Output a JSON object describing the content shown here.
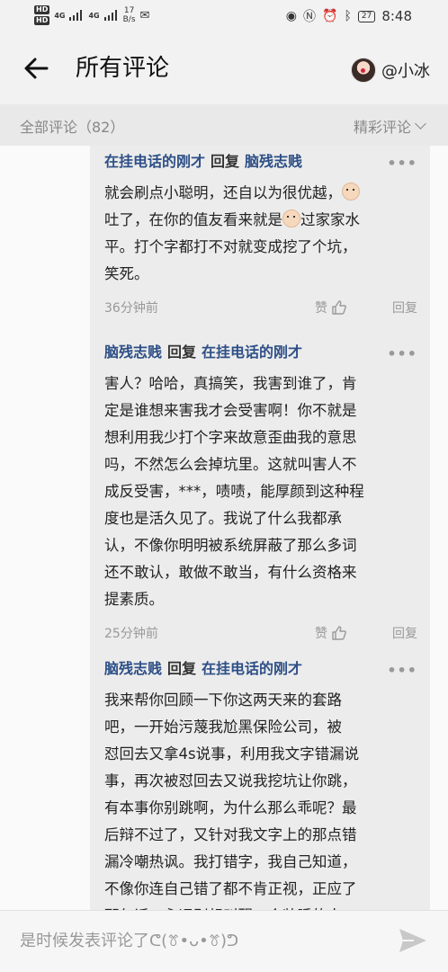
{
  "status_bar": {
    "hd1": "HD",
    "hd2": "HD",
    "net1": "4G",
    "net2": "4G",
    "speed_value": "17",
    "speed_unit": "B/s",
    "battery": "27",
    "time": "8:48"
  },
  "header": {
    "title": "所有评论",
    "username": "@小冰"
  },
  "filter": {
    "all_label": "全部评论（82）",
    "selected_label": "精彩评论"
  },
  "replies": [
    {
      "author": "在挂电话的刚才",
      "reply_word": "回复",
      "target": "脑残志贱",
      "line1a": "就会刷点小聪明，还自以为很优越，",
      "line2a": "吐了，在你的值友看来就是",
      "line2b": "过家家水",
      "rest": "平。打个字都打不对就变成挖了个坑，\n笑死。",
      "time": "36分钟前",
      "like": "赞",
      "reply": "回复"
    },
    {
      "author": "脑残志贱",
      "reply_word": "回复",
      "target": "在挂电话的刚才",
      "body": "害人？哈哈，真搞笑，我害到谁了，肯\n定是谁想来害我才会受害啊！你不就是\n想利用我少打个字来故意歪曲我的意思\n吗，不然怎么会掉坑里。这就叫害人不\n成反受害，***，啧啧，能厚颜到这种程\n度也是活久见了。我说了什么我都承\n认，不像你明明被系统屏蔽了那么多词\n还不敢认，敢做不敢当，有什么资格来\n提素质。",
      "time": "25分钟前",
      "like": "赞",
      "reply": "回复"
    },
    {
      "author": "脑残志贱",
      "reply_word": "回复",
      "target": "在挂电话的刚才",
      "body": "我来帮你回顾一下你这两天来的套路\n吧，一开始污蔑我尬黑保险公司，被\n怼回去又拿4s说事，利用我文字错漏说\n事，再次被怼回去又说我挖坑让你跳，\n有本事你别跳啊，为什么那么乖呢？最\n后辩不过了，又针对我文字上的那点错\n漏冷嘲热讽。我打错字，我自己知道，\n不像你连自己错了都不肯正视，正应了\n那句话，永远别想叫醒一个装睡的人。"
    }
  ],
  "input": {
    "placeholder": "是时候发表评论了ᕦ(ꔢ•ᴗ•ꔢ)ᕤ"
  },
  "icons": {
    "back": "arrow-left-icon",
    "more": "more-dots-icon",
    "like": "thumbs-up-icon",
    "send": "send-icon",
    "emoji": "baby-face-emoji"
  }
}
